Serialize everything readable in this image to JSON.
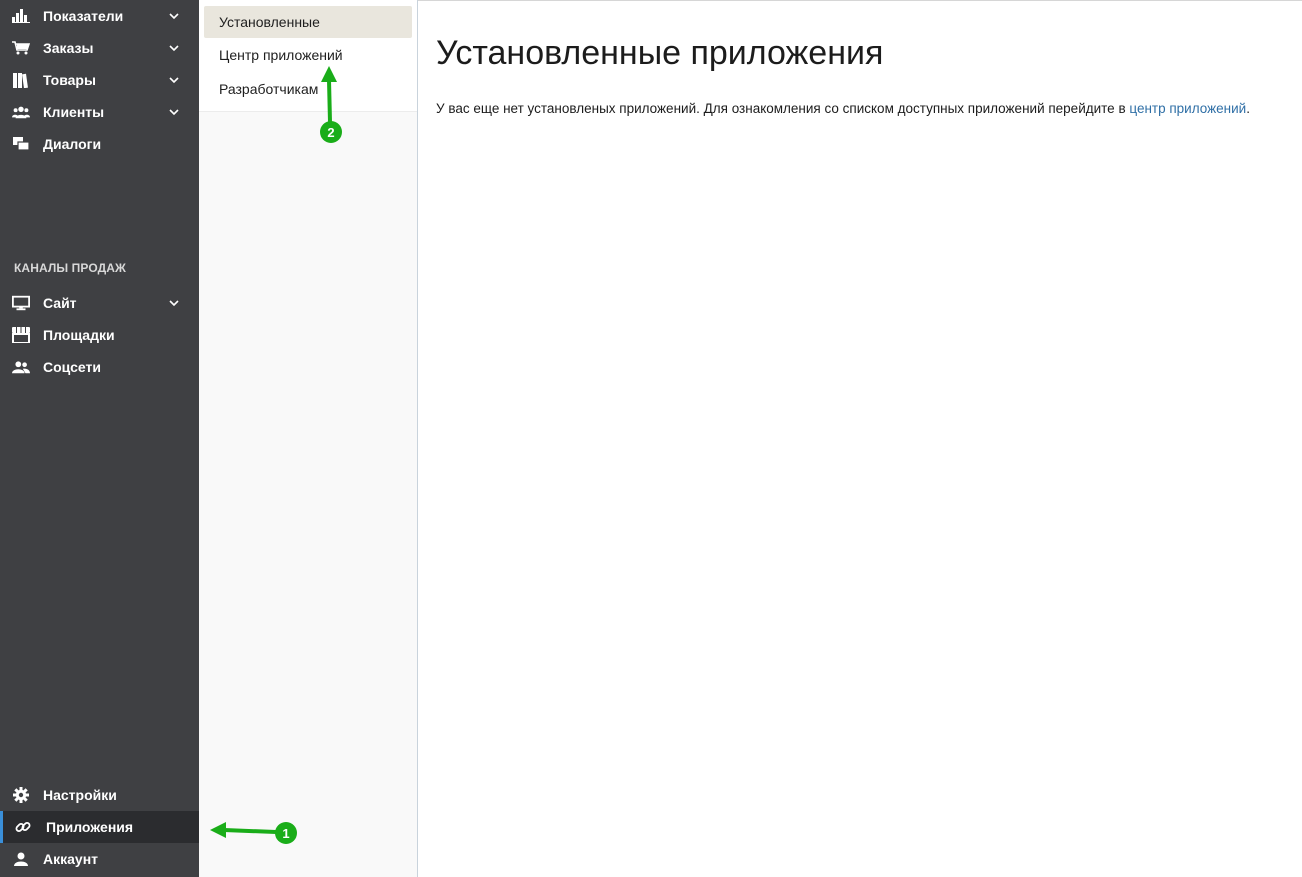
{
  "sidebar": {
    "items": [
      {
        "label": "Показатели",
        "icon": "bar-chart-icon",
        "has_chevron": true
      },
      {
        "label": "Заказы",
        "icon": "cart-icon",
        "has_chevron": true
      },
      {
        "label": "Товары",
        "icon": "books-icon",
        "has_chevron": true
      },
      {
        "label": "Клиенты",
        "icon": "users-icon",
        "has_chevron": true
      },
      {
        "label": "Диалоги",
        "icon": "chat-icon",
        "has_chevron": false
      }
    ],
    "section_title": "КАНАЛЫ ПРОДАЖ",
    "channels": [
      {
        "label": "Сайт",
        "icon": "monitor-icon",
        "has_chevron": true
      },
      {
        "label": "Площадки",
        "icon": "store-icon",
        "has_chevron": false
      },
      {
        "label": "Соцсети",
        "icon": "people-icon",
        "has_chevron": false
      }
    ],
    "bottom": [
      {
        "label": "Настройки",
        "icon": "gear-icon",
        "active": false
      },
      {
        "label": "Приложения",
        "icon": "link-icon",
        "active": true
      },
      {
        "label": "Аккаунт",
        "icon": "user-icon",
        "active": false
      }
    ]
  },
  "submenu": {
    "items": [
      {
        "label": "Установленные",
        "selected": true
      },
      {
        "label": "Центр приложений",
        "selected": false
      },
      {
        "label": "Разработчикам",
        "selected": false
      }
    ]
  },
  "main": {
    "title": "Установленные приложения",
    "message_text": "У вас еще нет установленых приложений. Для ознакомления со списком доступных приложений перейдите в ",
    "message_link": "центр приложений",
    "message_end": "."
  },
  "annotations": [
    {
      "number": "1"
    },
    {
      "number": "2"
    }
  ],
  "colors": {
    "sidebar_bg": "#3f4043",
    "active_bg": "#2b2c2f",
    "active_accent": "#3a8fd9",
    "selected_bg": "#e9e6dd",
    "link": "#2f6fa6",
    "annotation_green": "#1aad19"
  }
}
